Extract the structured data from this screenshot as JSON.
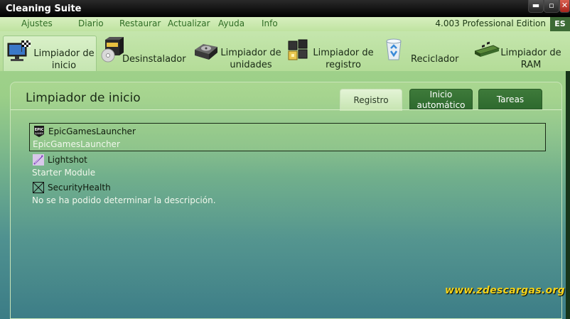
{
  "window": {
    "title": "Cleaning Suite"
  },
  "menu": {
    "items": [
      "Ajustes",
      "Diario",
      "Restaurar",
      "Actualizar",
      "Ayuda",
      "Info"
    ],
    "edition": "4.003 Professional Edition",
    "language": "ES"
  },
  "toolbar": {
    "tools": [
      {
        "label": "Limpiador de inicio",
        "icon": "monitor-flag-icon",
        "active": true
      },
      {
        "label": "Desinstalador",
        "icon": "software-box-cd-icon"
      },
      {
        "label": "Limpiador de unidades",
        "icon": "hard-drive-icon"
      },
      {
        "label": "Limpiador de registro",
        "icon": "registry-cubes-icon"
      },
      {
        "label": "Reciclador",
        "icon": "recycle-bin-icon"
      },
      {
        "label": "Limpiador de RAM",
        "icon": "ram-module-icon"
      }
    ]
  },
  "panel": {
    "title": "Limpiador de inicio",
    "tabs": [
      {
        "label": "Registro",
        "selected": true
      },
      {
        "label": "Inicio automático"
      },
      {
        "label": "Tareas"
      }
    ],
    "entries": [
      {
        "name": "EpicGamesLauncher",
        "description": "EpicGamesLauncher",
        "icon": "epic-games-icon",
        "selected": true
      },
      {
        "name": "Lightshot",
        "description": "Starter Module",
        "icon": "lightshot-feather-icon"
      },
      {
        "name": "SecurityHealth",
        "description": "No se ha podido determinar la descripción.",
        "icon": "security-health-icon"
      }
    ]
  },
  "watermark": "www.zdescargas.org",
  "colors": {
    "accent": "#2f6d25",
    "tab_dark": "#2e6a2e",
    "watermark": "#f3d21a"
  }
}
